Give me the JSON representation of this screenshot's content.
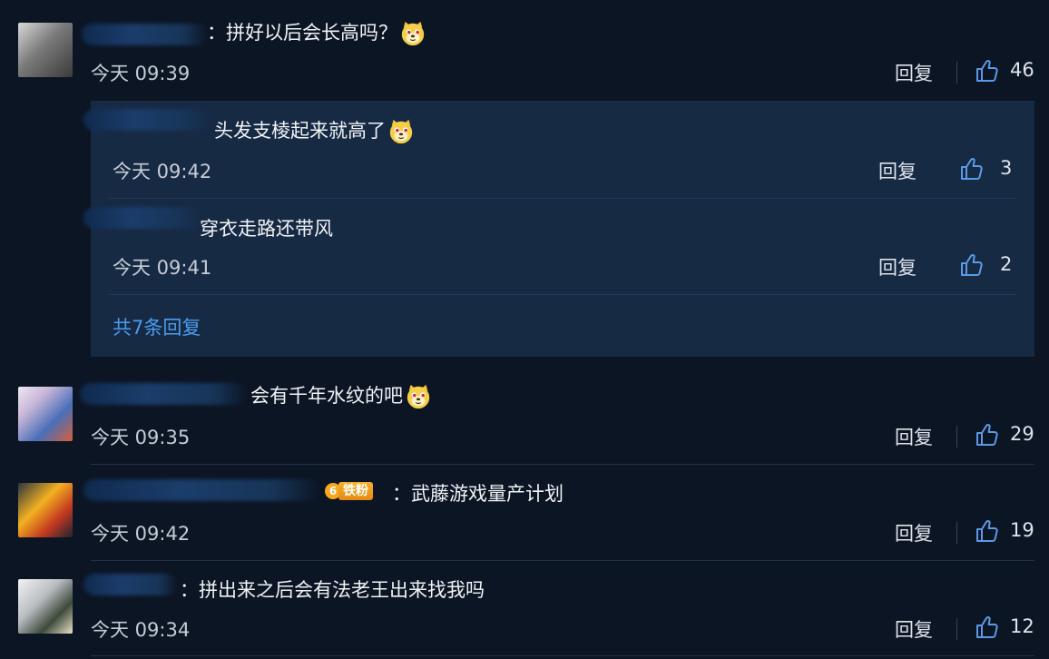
{
  "comments": [
    {
      "text": "：拼好以后会长高吗？",
      "time": "今天 09:39",
      "reply_label": "回复",
      "likes": "46",
      "replies": [
        {
          "text": "头发支棱起来就高了",
          "time": "今天 09:42",
          "reply_label": "回复",
          "likes": "3"
        },
        {
          "text": "穿衣走路还带风",
          "time": "今天 09:41",
          "reply_label": "回复",
          "likes": "2"
        }
      ],
      "more_replies": "共7条回复"
    },
    {
      "text": "会有千年水纹的吧",
      "time": "今天 09:35",
      "reply_label": "回复",
      "likes": "29"
    },
    {
      "badge": "6 铁粉",
      "badge_text": "铁粉",
      "badge_level": "6",
      "text": "：武藤游戏量产计划",
      "time": "今天 09:42",
      "reply_label": "回复",
      "likes": "19"
    },
    {
      "text": "：拼出来之后会有法老王出来找我吗",
      "time": "今天 09:34",
      "reply_label": "回复",
      "likes": "12"
    }
  ],
  "colors": {
    "background": "#0c1524",
    "reply_box": "#172a44",
    "link": "#4b9cf0",
    "badge": "#f6b02b"
  },
  "icons": [
    "thumbs-up-icon",
    "doge-emoji-icon"
  ]
}
